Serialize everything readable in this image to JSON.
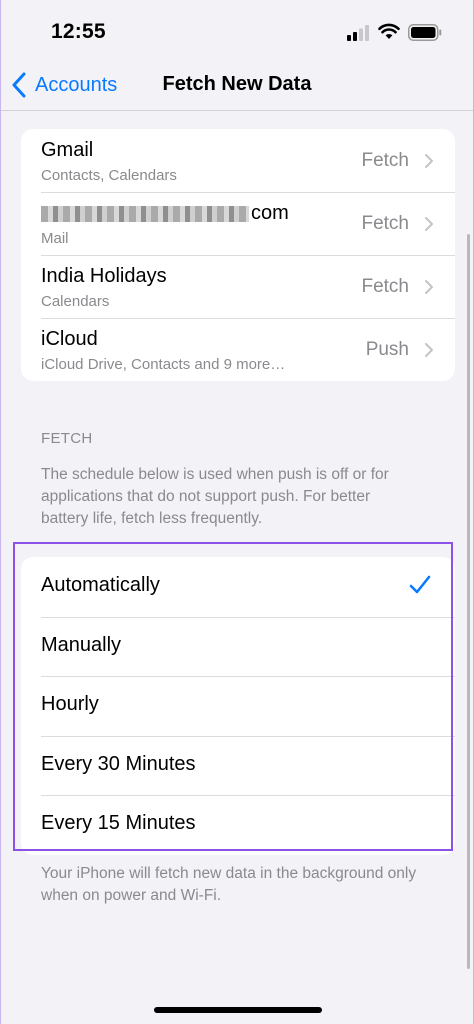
{
  "status": {
    "time": "12:55"
  },
  "nav": {
    "back_label": "Accounts",
    "title": "Fetch New Data"
  },
  "accounts": [
    {
      "name": "Gmail",
      "detail": "Contacts, Calendars",
      "setting": "Fetch"
    },
    {
      "name": "com",
      "detail": "Mail",
      "setting": "Fetch"
    },
    {
      "name": "India Holidays",
      "detail": "Calendars",
      "setting": "Fetch"
    },
    {
      "name": "iCloud",
      "detail": "iCloud Drive, Contacts and 9 more…",
      "setting": "Push"
    }
  ],
  "fetch": {
    "header": "FETCH",
    "description": "The schedule below is used when push is off or for applications that do not support push. For better battery life, fetch less frequently.",
    "options": [
      {
        "label": "Automatically",
        "selected": true
      },
      {
        "label": "Manually",
        "selected": false
      },
      {
        "label": "Hourly",
        "selected": false
      },
      {
        "label": "Every 30 Minutes",
        "selected": false
      },
      {
        "label": "Every 15 Minutes",
        "selected": false
      }
    ],
    "footer": "Your iPhone will fetch new data in the background only when on power and Wi-Fi."
  },
  "colors": {
    "accent": "#0a7aff",
    "highlight": "#8c52e8",
    "background": "#f2f2f7"
  }
}
